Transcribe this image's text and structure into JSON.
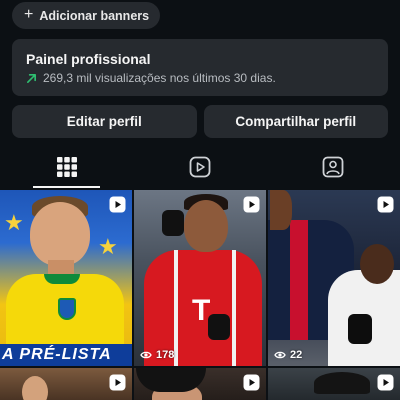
{
  "header": {
    "add_banners_icon": "plus-icon",
    "add_banners_label": "Adicionar banners"
  },
  "dashboard": {
    "title": "Painel profissional",
    "trend_icon": "trend-up-arrow-icon",
    "trend_color": "#2fbf71",
    "subtitle": "269,3 mil visualizações nos últimos 30 dias."
  },
  "actions": {
    "edit_label": "Editar perfil",
    "share_label": "Compartilhar perfil"
  },
  "tabs": [
    {
      "icon": "grid-icon",
      "active": true
    },
    {
      "icon": "reels-icon",
      "active": false
    },
    {
      "icon": "tagged-icon",
      "active": false
    }
  ],
  "posts": [
    {
      "type": "reel",
      "overlay_text": "A PRÉ-LISTA"
    },
    {
      "type": "reel",
      "views": "178"
    },
    {
      "type": "reel",
      "views": "22"
    },
    {
      "type": "reel"
    },
    {
      "type": "reel"
    },
    {
      "type": "reel"
    }
  ],
  "colors": {
    "background": "#0c1014",
    "card": "#262a2f",
    "text": "#f5f5f5"
  }
}
